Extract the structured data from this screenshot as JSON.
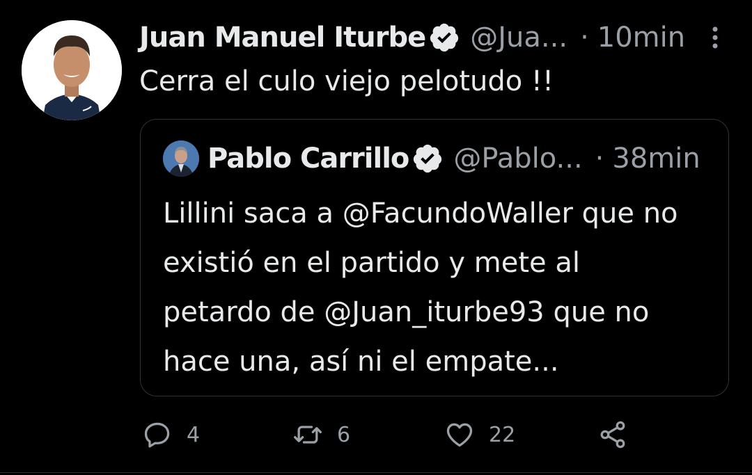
{
  "tweet": {
    "author_name": "Juan Manuel Iturbe",
    "handle": "@Jua...",
    "separator": "·",
    "time": "10min",
    "text": "Cerra el culo viejo pelotudo !!"
  },
  "quoted_tweet": {
    "author_name": "Pablo Carrillo",
    "handle": "@Pablo...",
    "separator": "·",
    "time": "38min",
    "text_lines": [
      "Lillini saca a @FacundoWaller que no",
      "existió en el partido y mete al",
      "petardo de @Juan_iturbe93 que no",
      "hace una, así ni el empate..."
    ]
  },
  "actions": {
    "replies": "4",
    "retweets": "6",
    "likes": "22"
  },
  "icons": {
    "verified": "verified-badge-icon",
    "more": "more-vertical-icon",
    "reply": "reply-icon",
    "retweet": "retweet-icon",
    "like": "heart-icon",
    "share": "share-icon"
  },
  "colors": {
    "background": "#000000",
    "text": "#e7e9ea",
    "muted": "#9aa0a6",
    "border": "#2f3336"
  }
}
